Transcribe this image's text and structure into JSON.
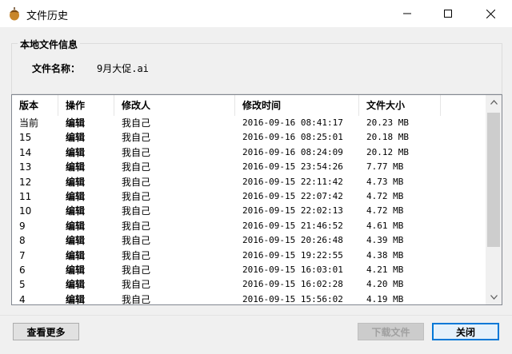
{
  "window": {
    "title": "文件历史",
    "minimize_icon": "minimize-icon",
    "maximize_icon": "maximize-icon",
    "close_icon": "close-icon"
  },
  "file_info": {
    "group_title": "本地文件信息",
    "name_label": "文件名称：",
    "name_value": "9月大促.ai"
  },
  "table": {
    "columns": [
      "版本",
      "操作",
      "修改人",
      "修改时间",
      "文件大小"
    ],
    "rows": [
      [
        "当前",
        "编辑",
        "我自己",
        "2016-09-16 08:41:17",
        "20.23 MB"
      ],
      [
        "15",
        "编辑",
        "我自己",
        "2016-09-16 08:25:01",
        "20.18 MB"
      ],
      [
        "14",
        "编辑",
        "我自己",
        "2016-09-16 08:24:09",
        "20.12 MB"
      ],
      [
        "13",
        "编辑",
        "我自己",
        "2016-09-15 23:54:26",
        "7.77 MB"
      ],
      [
        "12",
        "编辑",
        "我自己",
        "2016-09-15 22:11:42",
        "4.73 MB"
      ],
      [
        "11",
        "编辑",
        "我自己",
        "2016-09-15 22:07:42",
        "4.72 MB"
      ],
      [
        "10",
        "编辑",
        "我自己",
        "2016-09-15 22:02:13",
        "4.72 MB"
      ],
      [
        "9",
        "编辑",
        "我自己",
        "2016-09-15 21:46:52",
        "4.61 MB"
      ],
      [
        "8",
        "编辑",
        "我自己",
        "2016-09-15 20:26:48",
        "4.39 MB"
      ],
      [
        "7",
        "编辑",
        "我自己",
        "2016-09-15 19:22:55",
        "4.38 MB"
      ],
      [
        "6",
        "编辑",
        "我自己",
        "2016-09-15 16:03:01",
        "4.21 MB"
      ],
      [
        "5",
        "编辑",
        "我自己",
        "2016-09-15 16:02:28",
        "4.20 MB"
      ],
      [
        "4",
        "编辑",
        "我自己",
        "2016-09-15 15:56:02",
        "4.19 MB"
      ]
    ]
  },
  "buttons": {
    "more": "查看更多",
    "download": "下载文件",
    "close": "关闭"
  },
  "colors": {
    "accent": "#0078d7",
    "disabled_text": "#a0a0a0"
  }
}
